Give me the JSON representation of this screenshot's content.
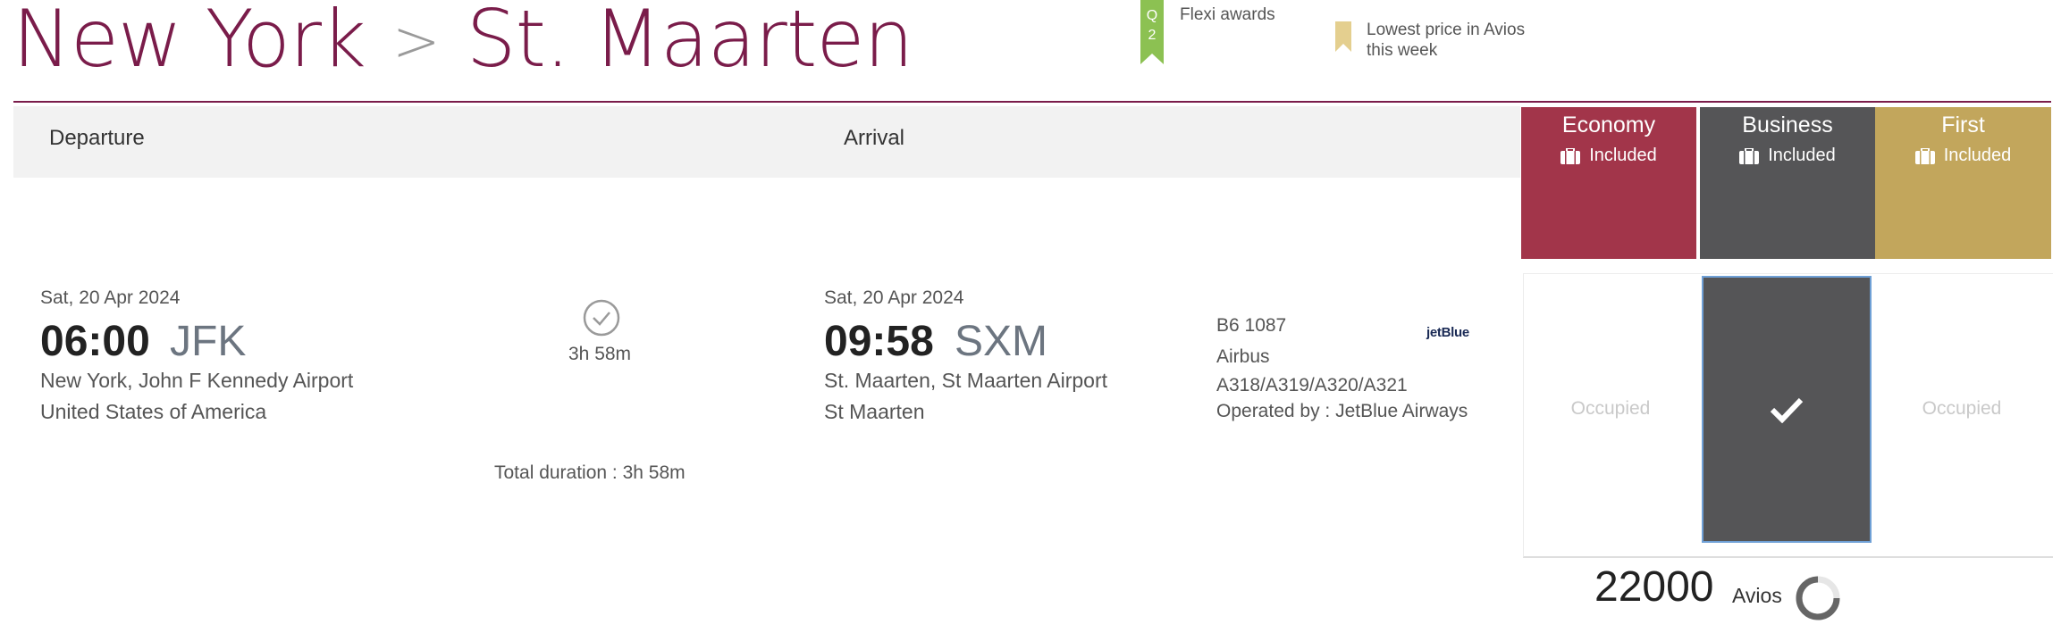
{
  "route": {
    "origin": "New York",
    "separator": ">",
    "destination": "St. Maarten"
  },
  "legend": {
    "flexi_badge": "Q2",
    "flexi_label": "Flexi awards",
    "lowest_label_line1": "Lowest price in Avios",
    "lowest_label_line2": "this week",
    "flexi_color": "#8cc152",
    "bookmark_color": "#e4cf8f"
  },
  "table_header": {
    "departure": "Departure",
    "arrival": "Arrival"
  },
  "cabins": [
    {
      "name": "Economy",
      "baggage": "Included",
      "color": "#a2354a"
    },
    {
      "name": "Business",
      "baggage": "Included",
      "color": "#555557"
    },
    {
      "name": "First",
      "baggage": "Included",
      "color": "#c2a65c"
    }
  ],
  "flight": {
    "departure": {
      "date": "Sat, 20 Apr 2024",
      "time": "06:00",
      "code": "JFK",
      "airport": "New York, John F Kennedy Airport",
      "country": "United States of America"
    },
    "duration": "3h 58m",
    "arrival": {
      "date": "Sat, 20 Apr 2024",
      "time": "09:58",
      "code": "SXM",
      "airport": "St. Maarten, St Maarten Airport",
      "country": "St Maarten"
    },
    "flight_number": "B6 1087",
    "aircraft_line1": "Airbus",
    "aircraft_line2": "A318/A319/A320/A321",
    "operated_by": "Operated by : JetBlue Airways",
    "airline_logo": "jetBlue",
    "total_duration": "Total duration : 3h 58m"
  },
  "fares": {
    "economy": "Occupied",
    "business_selected": true,
    "first": "Occupied"
  },
  "price": {
    "amount": "22000",
    "unit": "Avios"
  },
  "colors": {
    "brand": "#7a1c4a",
    "selection_border": "#6fa0d6"
  }
}
